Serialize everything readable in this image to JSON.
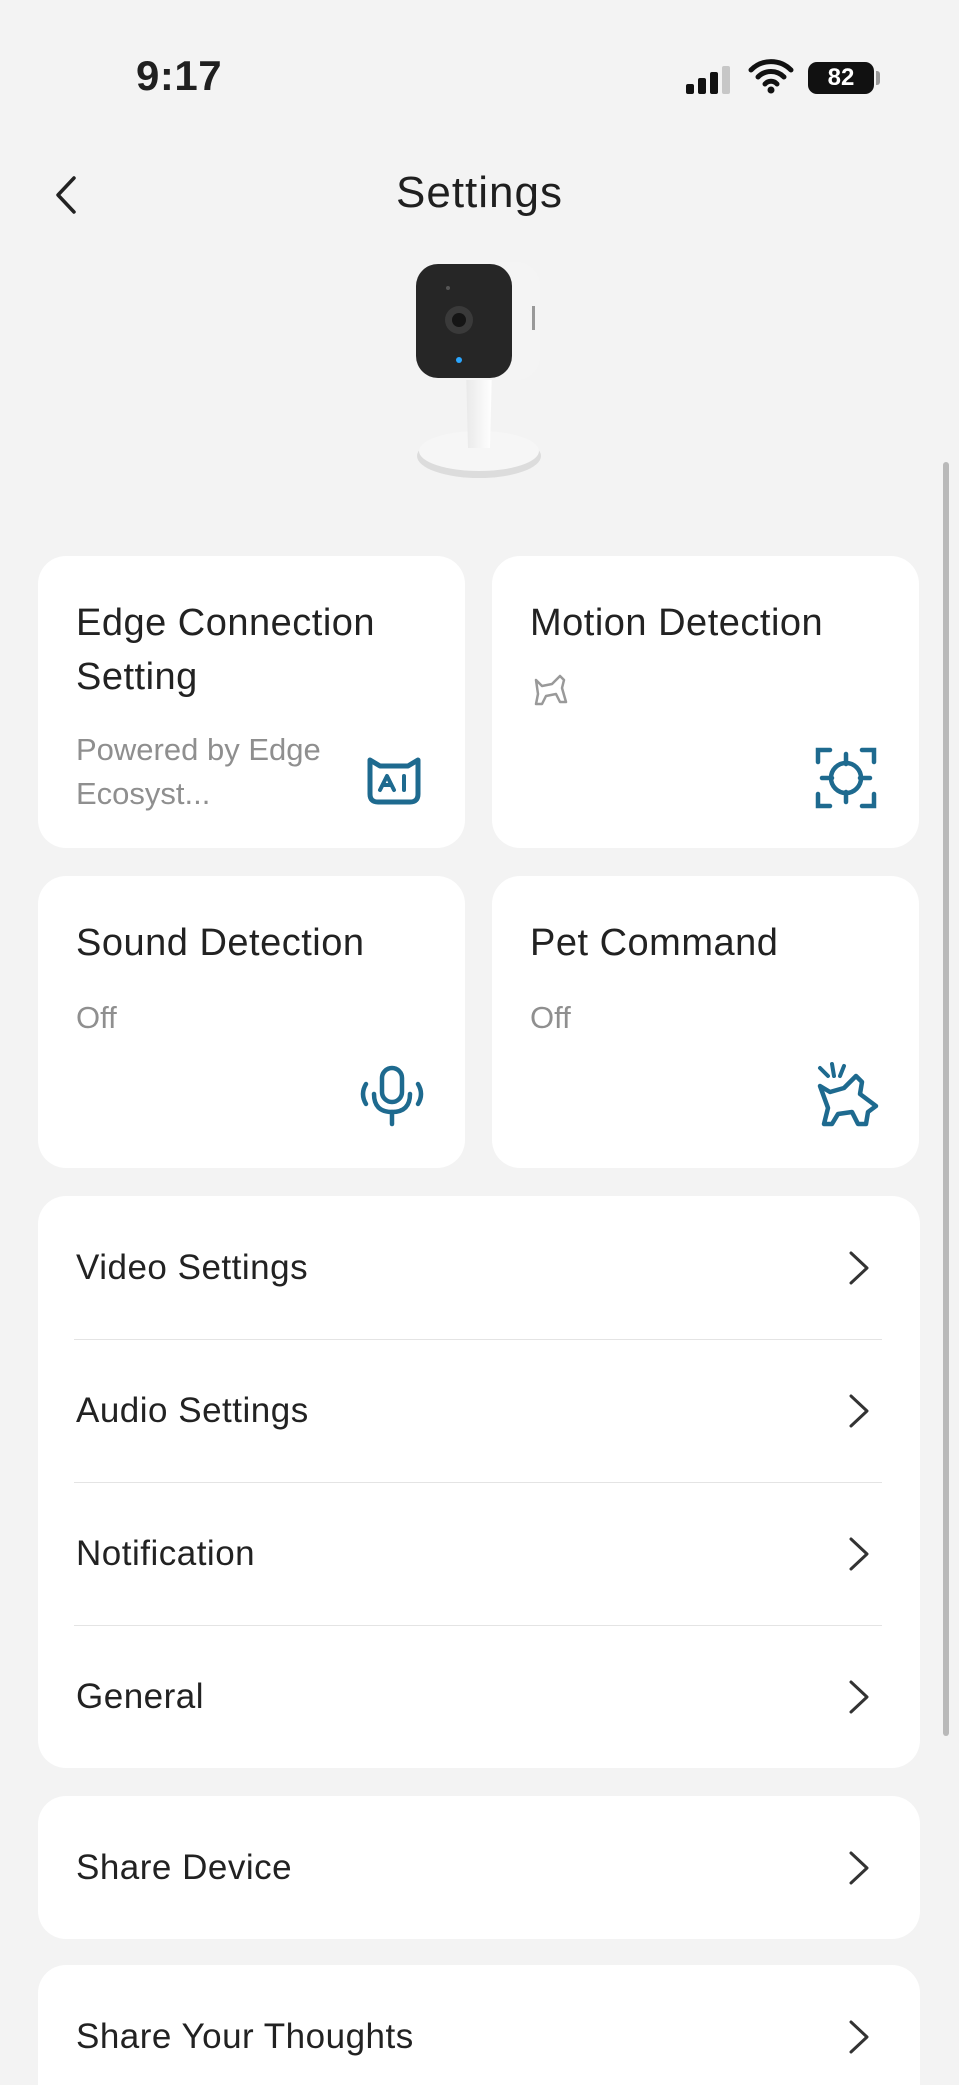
{
  "status_bar": {
    "time": "9:17",
    "battery": "82"
  },
  "header": {
    "title": "Settings"
  },
  "tiles": [
    {
      "title": "Edge Connection Setting",
      "subtitle": "Powered by Edge Ecosyst...",
      "icon": "ai-bot-icon"
    },
    {
      "title": "Motion Detection",
      "subtitle": "",
      "icon": "target-icon"
    },
    {
      "title": "Sound Detection",
      "subtitle": "Off",
      "icon": "microphone-icon"
    },
    {
      "title": "Pet Command",
      "subtitle": "Off",
      "icon": "pet-command-icon"
    }
  ],
  "settings_list": [
    {
      "label": "Video Settings"
    },
    {
      "label": "Audio Settings"
    },
    {
      "label": "Notification"
    },
    {
      "label": "General"
    }
  ],
  "share_device": {
    "label": "Share Device"
  },
  "share_thoughts": {
    "label": "Share Your Thoughts"
  },
  "colors": {
    "accent": "#1e6a8f",
    "background": "#f3f3f3",
    "card": "#ffffff"
  }
}
